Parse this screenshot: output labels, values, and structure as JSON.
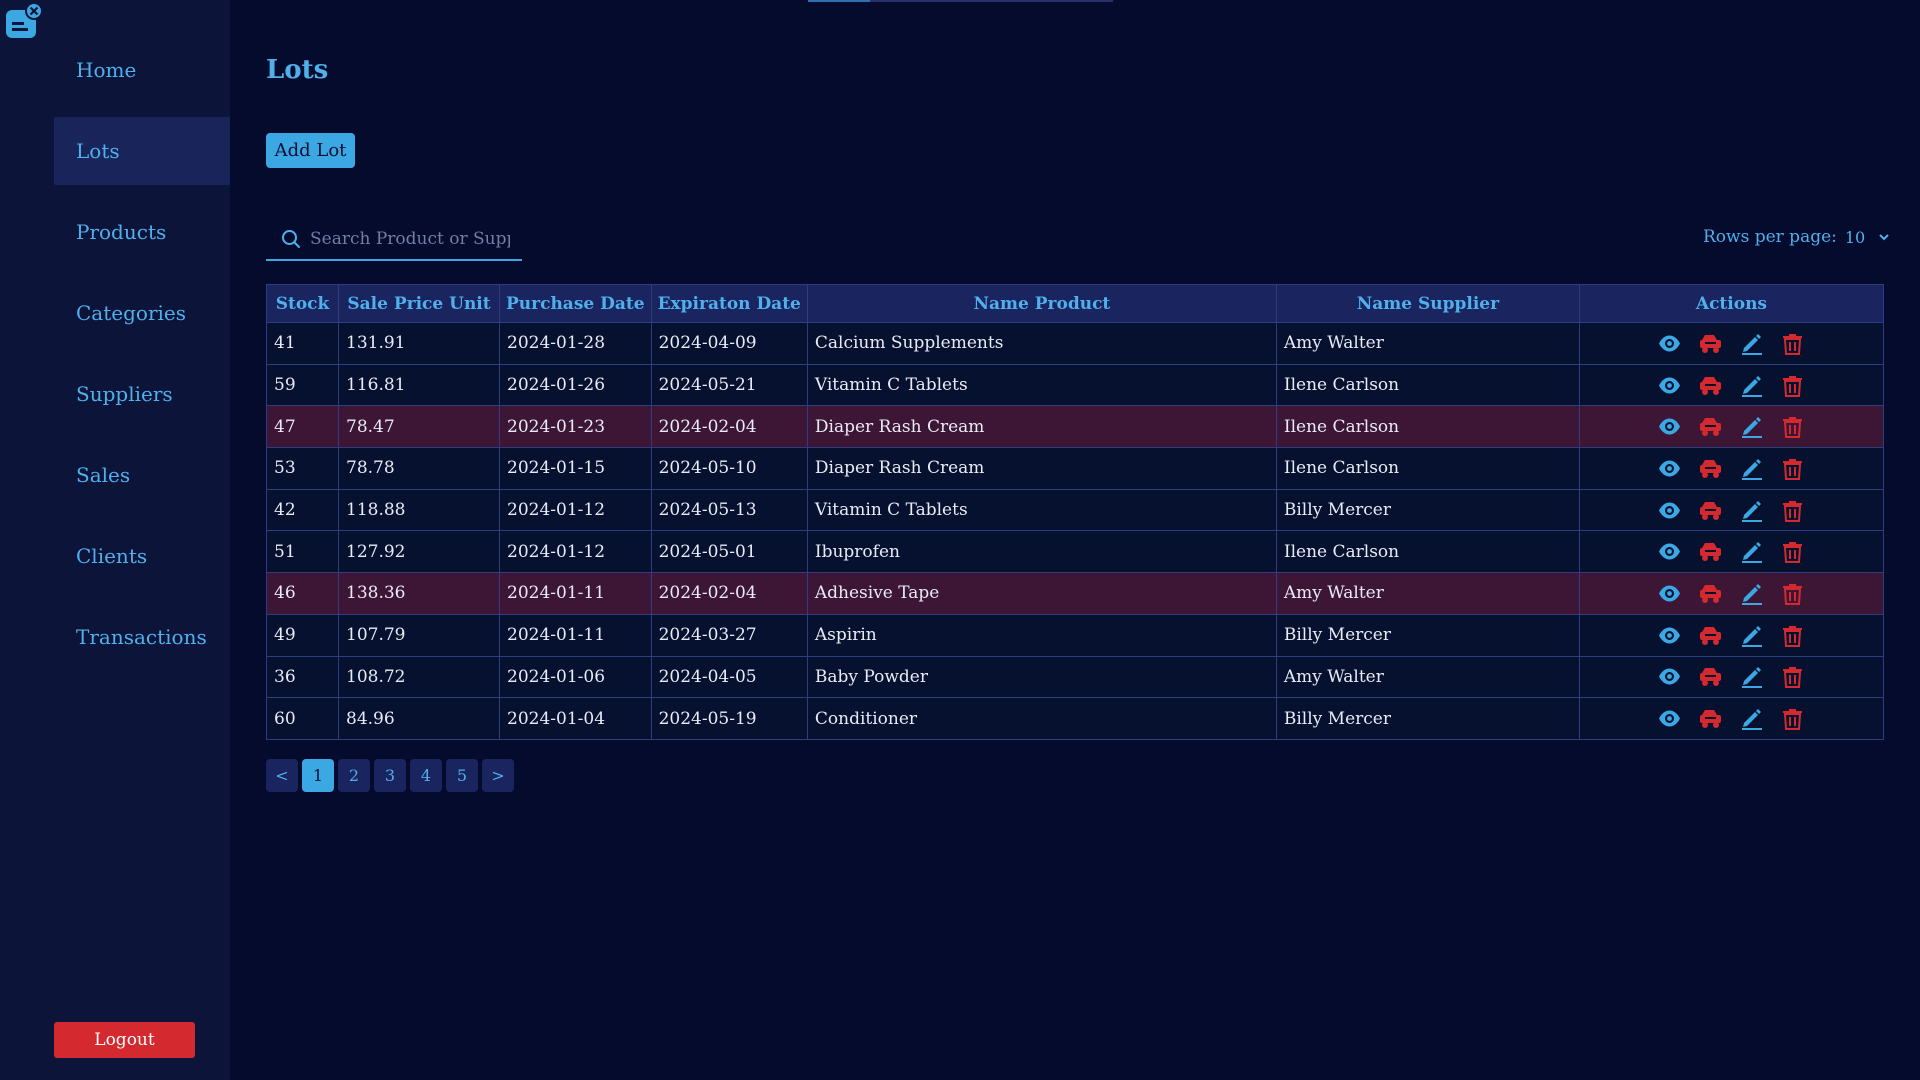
{
  "sidebar": {
    "logo": "app-logo-icon",
    "items": [
      {
        "label": "Home",
        "active": false
      },
      {
        "label": "Lots",
        "active": true
      },
      {
        "label": "Products",
        "active": false
      },
      {
        "label": "Categories",
        "active": false
      },
      {
        "label": "Suppliers",
        "active": false
      },
      {
        "label": "Sales",
        "active": false
      },
      {
        "label": "Clients",
        "active": false
      },
      {
        "label": "Transactions",
        "active": false
      }
    ],
    "logout_label": "Logout"
  },
  "main": {
    "title": "Lots",
    "add_label": "Add Lot",
    "search": {
      "placeholder": "Search Product or Supplier",
      "value": ""
    },
    "rows_per_page": {
      "label": "Rows per page:",
      "value": "10"
    }
  },
  "table": {
    "columns": [
      "Stock",
      "Sale Price Unit",
      "Purchase Date",
      "Expiraton Date",
      "Name Product",
      "Name Supplier",
      "Actions"
    ],
    "rows": [
      {
        "stock": "41",
        "price": "131.91",
        "purchase": "2024-01-28",
        "expiration": "2024-04-09",
        "product": "Calcium Supplements",
        "supplier": "Amy Walter",
        "expiring": false
      },
      {
        "stock": "59",
        "price": "116.81",
        "purchase": "2024-01-26",
        "expiration": "2024-05-21",
        "product": "Vitamin C Tablets",
        "supplier": "Ilene Carlson",
        "expiring": false
      },
      {
        "stock": "47",
        "price": "78.47",
        "purchase": "2024-01-23",
        "expiration": "2024-02-04",
        "product": "Diaper Rash Cream",
        "supplier": "Ilene Carlson",
        "expiring": true
      },
      {
        "stock": "53",
        "price": "78.78",
        "purchase": "2024-01-15",
        "expiration": "2024-05-10",
        "product": "Diaper Rash Cream",
        "supplier": "Ilene Carlson",
        "expiring": false
      },
      {
        "stock": "42",
        "price": "118.88",
        "purchase": "2024-01-12",
        "expiration": "2024-05-13",
        "product": "Vitamin C Tablets",
        "supplier": "Billy Mercer",
        "expiring": false
      },
      {
        "stock": "51",
        "price": "127.92",
        "purchase": "2024-01-12",
        "expiration": "2024-05-01",
        "product": "Ibuprofen",
        "supplier": "Ilene Carlson",
        "expiring": false
      },
      {
        "stock": "46",
        "price": "138.36",
        "purchase": "2024-01-11",
        "expiration": "2024-02-04",
        "product": "Adhesive Tape",
        "supplier": "Amy Walter",
        "expiring": true
      },
      {
        "stock": "49",
        "price": "107.79",
        "purchase": "2024-01-11",
        "expiration": "2024-03-27",
        "product": "Aspirin",
        "supplier": "Billy Mercer",
        "expiring": false
      },
      {
        "stock": "36",
        "price": "108.72",
        "purchase": "2024-01-06",
        "expiration": "2024-04-05",
        "product": "Baby Powder",
        "supplier": "Amy Walter",
        "expiring": false
      },
      {
        "stock": "60",
        "price": "84.96",
        "purchase": "2024-01-04",
        "expiration": "2024-05-19",
        "product": "Conditioner",
        "supplier": "Billy Mercer",
        "expiring": false
      }
    ],
    "action_icons": [
      "eye-icon",
      "car-icon",
      "pencil-icon",
      "trash-icon"
    ]
  },
  "pagination": {
    "prev": "<",
    "next": ">",
    "pages": [
      "1",
      "2",
      "3",
      "4",
      "5"
    ],
    "current": "1"
  },
  "colors": {
    "accent": "#3ba7e3",
    "danger": "#d42a2f",
    "expiring_row": "#3d1535"
  }
}
